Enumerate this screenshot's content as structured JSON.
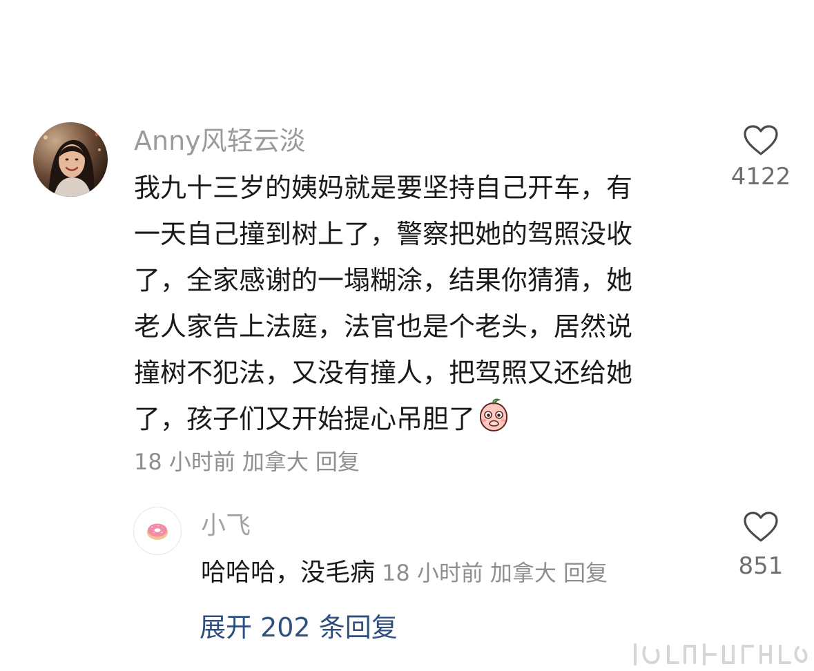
{
  "comment": {
    "username": "Anny风轻云淡",
    "lines": [
      "我九十三岁的姨妈就是要坚持自己开车，有",
      "一天自己撞到树上了，警察把她的驾照没收",
      "了，全家感谢的一塌糊涂，结果你猜猜，她",
      "老人家告上法庭，法官也是个老头，居然说",
      "撞树不犯法，又没有撞人，把驾照又还给她",
      "了，孩子们又开始提心吊胆了"
    ],
    "emoji": "peach-cover-mouth-emoji",
    "time": "18 小时前",
    "location": "加拿大",
    "reply_label": "回复",
    "likes": "4122"
  },
  "reply": {
    "username": "小飞",
    "text": "哈哈哈，没毛病",
    "time": "18 小时前",
    "location": "加拿大",
    "reply_label": "回复",
    "likes": "851"
  },
  "expand_label": "展开 202 条回复",
  "colors": {
    "username": "#9b9b9b",
    "text": "#1a1a1a",
    "meta": "#8f8f8f",
    "link": "#2f4f7f",
    "heart_outline": "#4a4a4a"
  }
}
